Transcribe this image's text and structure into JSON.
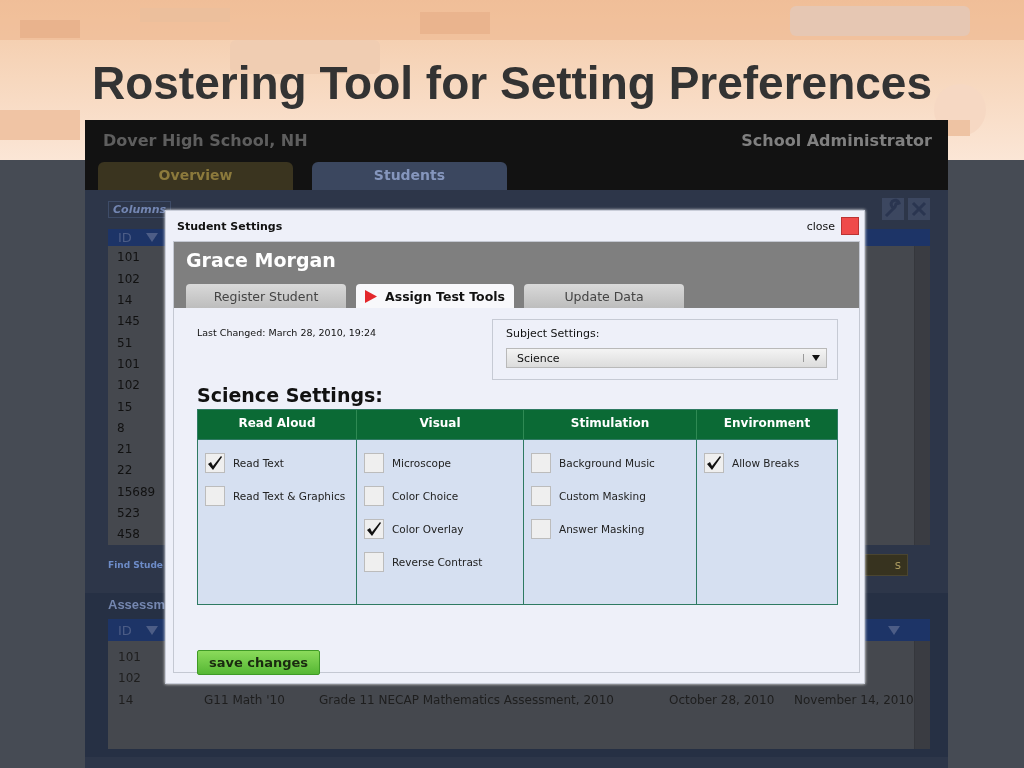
{
  "slide": {
    "title": "Rostering Tool for Setting Preferences"
  },
  "app": {
    "school": "Dover High School, NH",
    "role": "School Administrator",
    "tabs": [
      {
        "label": "Overview",
        "selected": false
      },
      {
        "label": "Students",
        "selected": true
      }
    ],
    "columns_button": "Columns",
    "students_table": {
      "header": "ID",
      "rows": [
        "101",
        "102",
        "14",
        "145",
        "51",
        "101",
        "102",
        "15",
        "8",
        "21",
        "22",
        "15689",
        "523",
        "458"
      ]
    },
    "find_link": "Find Stude",
    "button_fragment": "s",
    "assessments": {
      "title": "Assessm",
      "header": "ID",
      "rows": [
        {
          "id": "101"
        },
        {
          "id": "102"
        },
        {
          "id": "14",
          "code": "G11 Math '10",
          "name": "Grade 11 NECAP Mathematics Assessment, 2010",
          "start": "October 28, 2010",
          "end": "November 14, 2010"
        }
      ]
    }
  },
  "dialog": {
    "title": "Student Settings",
    "close": "close",
    "student": "Grace Morgan",
    "tabs": [
      {
        "label": "Register Student",
        "selected": false
      },
      {
        "label": "Assign Test Tools",
        "selected": true
      },
      {
        "label": "Update Data",
        "selected": false
      }
    ],
    "last_changed": "Last Changed: March 28, 2010, 19:24",
    "subject_label": "Subject Settings:",
    "subject_value": "Science",
    "heading": "Science Settings:",
    "groups": [
      {
        "title": "Read Aloud",
        "options": [
          {
            "label": "Read Text",
            "checked": true
          },
          {
            "label": "Read Text & Graphics",
            "checked": false
          }
        ]
      },
      {
        "title": "Visual",
        "options": [
          {
            "label": "Microscope",
            "checked": false
          },
          {
            "label": "Color Choice",
            "checked": false
          },
          {
            "label": "Color Overlay",
            "checked": true
          },
          {
            "label": "Reverse Contrast",
            "checked": false
          }
        ]
      },
      {
        "title": "Stimulation",
        "options": [
          {
            "label": "Background Music",
            "checked": false
          },
          {
            "label": "Custom Masking",
            "checked": false
          },
          {
            "label": "Answer Masking",
            "checked": false
          }
        ]
      },
      {
        "title": "Environment",
        "options": [
          {
            "label": "Allow Breaks",
            "checked": true
          }
        ]
      }
    ],
    "save": "save changes"
  }
}
